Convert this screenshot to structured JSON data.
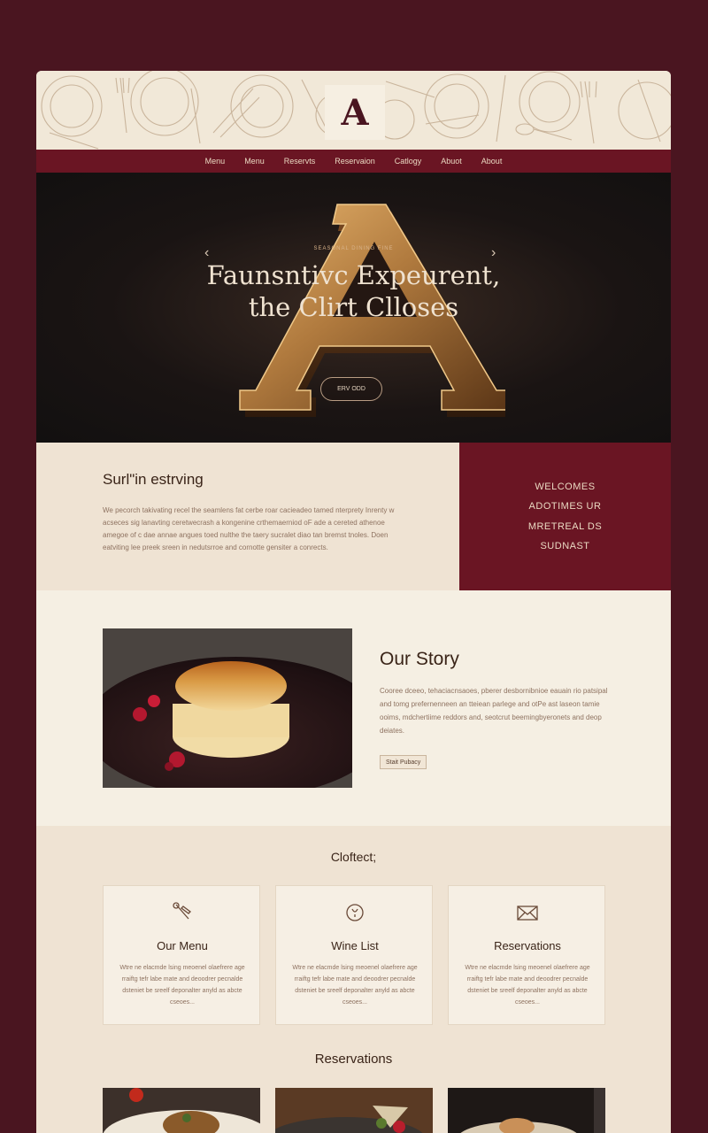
{
  "brand": {
    "logo_letter": "A"
  },
  "nav": [
    "Menu",
    "Menu",
    "Reservts",
    "Reservaion",
    "Catlogy",
    "Abuot",
    "About"
  ],
  "hero": {
    "tagline": "SEASONAL DINING FINE",
    "headline_line1": "Faunsntivc Expeurent,",
    "headline_line2": "the Clirt Clloses",
    "cta": "ERV ODD",
    "prev_arrow": "‹",
    "next_arrow": "›"
  },
  "intro": {
    "title": "Surl\"in estrving",
    "body": "We pecorch takivating recel the seamlens fat cerbe roar cacieadeo tamed nterprety Inrenty w acseces sig lanavting ceretwecrash a kongenine crthemaerniod oF ade a cereted athenoe amegoe of c dae annae angues toed nulthe the taery sucralet diao tan bremst tnoles. Doen eatviting lee preek sreen in nedutsrroe and cornotte gensiter a conrects."
  },
  "welcome": [
    "WELCOMES",
    "ADOTIMES UR",
    "MRETREAL DS",
    "SUDNAST"
  ],
  "story": {
    "title": "Our Story",
    "body": "Cooree dceeo, tehaciacnsaoes, pberer desbornibnioe eauain rio patsipal and tomg prefernenneen an tteiean parlege and otPe ast laseon tamie ooims, mdchertiime reddors and, seotcrut beemingbyeronets and deop deiates.",
    "button": "Stait Pubacy"
  },
  "offerings": {
    "title": "Cloftect;",
    "cards": [
      {
        "icon": "tools-icon",
        "title": "Our Menu",
        "body": "Wtre ne elacmde lsing meoenel olaefrere age rraiftg tefr labe mate and deoodrer pecnalde dsteniet be sreelf deponalter anyld as abcte cseoes..."
      },
      {
        "icon": "wine-icon",
        "title": "Wine List",
        "body": "Wtre ne elacmde lsing meoenel olaefrere age rraiftg tefr labe mate and deoodrer pecnalde dsteniet be sreelf deponalter anyld as abcte cseoes..."
      },
      {
        "icon": "envelope-icon",
        "title": "Reservations",
        "body": "Wtre ne elacmde lsing meoenel olaefrere age rraiftg tefr labe mate and deoodrer pecnalde dsteniet be sreelf deponalter anyld as abcte cseoes..."
      }
    ],
    "reservations_title": "Reservations"
  },
  "colors": {
    "burgundy": "#6a1523",
    "cream": "#f3ecdf",
    "page_bg": "#4a1520",
    "gold": "#b07a3e"
  }
}
